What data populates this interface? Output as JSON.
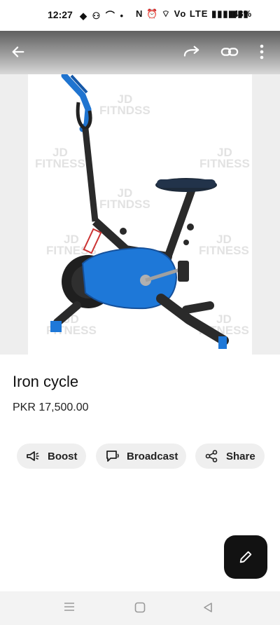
{
  "status": {
    "time": "12:27",
    "left_glyphs": "◆ ⚇ ⌒ •",
    "right_glyphs": "N ⏰ ⌔ Vo LTE ▮▮▮ ▮▮▮",
    "battery": "43%"
  },
  "watermark": {
    "line1": "JD",
    "line2": "FITNESS",
    "line2_alt": "FITNDSS"
  },
  "product": {
    "title": "Iron cycle",
    "price": "PKR 17,500.00"
  },
  "actions": {
    "boost": "Boost",
    "broadcast": "Broadcast",
    "share": "Share"
  },
  "colors": {
    "frame_blue": "#1e78d8",
    "frame_dark": "#2a2a2a",
    "fab": "#121212"
  }
}
